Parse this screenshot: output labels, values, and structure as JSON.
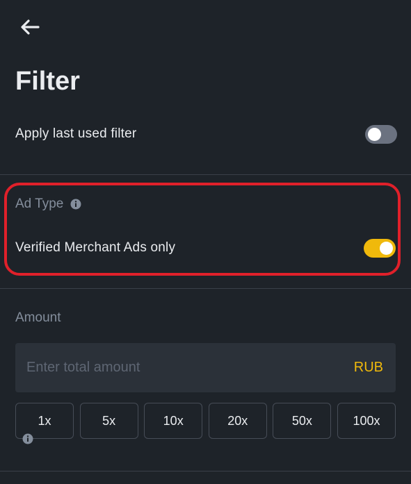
{
  "header": {
    "title": "Filter"
  },
  "apply_last": {
    "label": "Apply last used filter",
    "enabled": false
  },
  "ad_type": {
    "label": "Ad Type",
    "verified_label": "Verified Merchant Ads only",
    "verified_enabled": true
  },
  "amount": {
    "label": "Amount",
    "placeholder": "Enter total amount",
    "currency": "RUB",
    "multipliers": [
      "1x",
      "5x",
      "10x",
      "20x",
      "50x",
      "100x"
    ]
  },
  "colors": {
    "background": "#1e2329",
    "accent": "#f0b90b",
    "highlight": "#e0202a"
  }
}
